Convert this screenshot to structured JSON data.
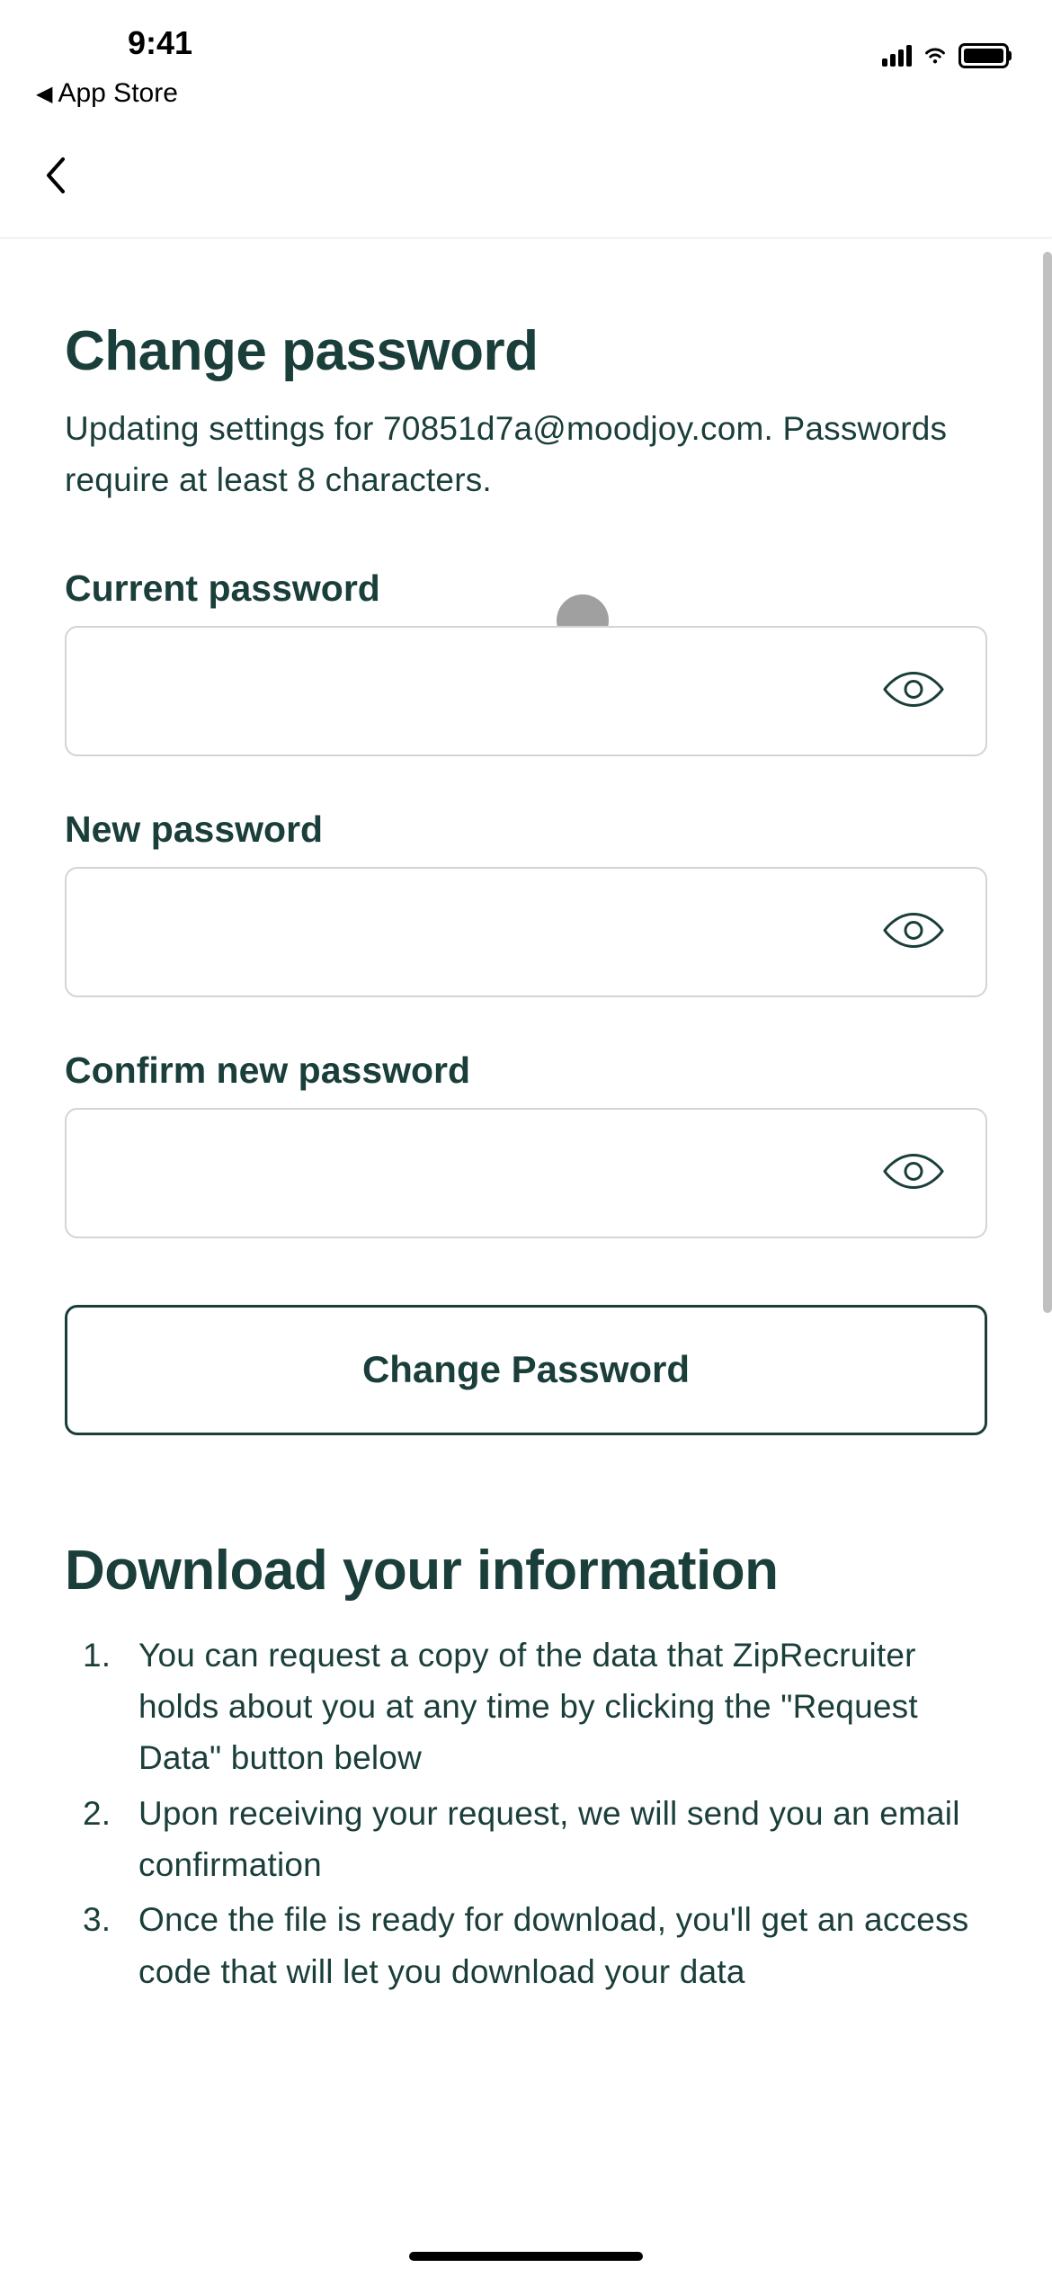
{
  "statusBar": {
    "time": "9:41",
    "breadcrumb": "App Store"
  },
  "page": {
    "title": "Change password",
    "subtitle": "Updating settings for 70851d7a@moodjoy.com. Passwords require at least 8 characters."
  },
  "form": {
    "currentPassword": {
      "label": "Current password",
      "value": ""
    },
    "newPassword": {
      "label": "New password",
      "value": ""
    },
    "confirmPassword": {
      "label": "Confirm new password",
      "value": ""
    },
    "submitLabel": "Change Password"
  },
  "downloadSection": {
    "title": "Download your information",
    "items": [
      "You can request a copy of the data that ZipRecruiter holds about you at any time by clicking the \"Request Data\" button below",
      "Upon receiving your request, we will send you an email confirmation",
      "Once the file is ready for download, you'll get an access code that will let you download your data"
    ]
  }
}
